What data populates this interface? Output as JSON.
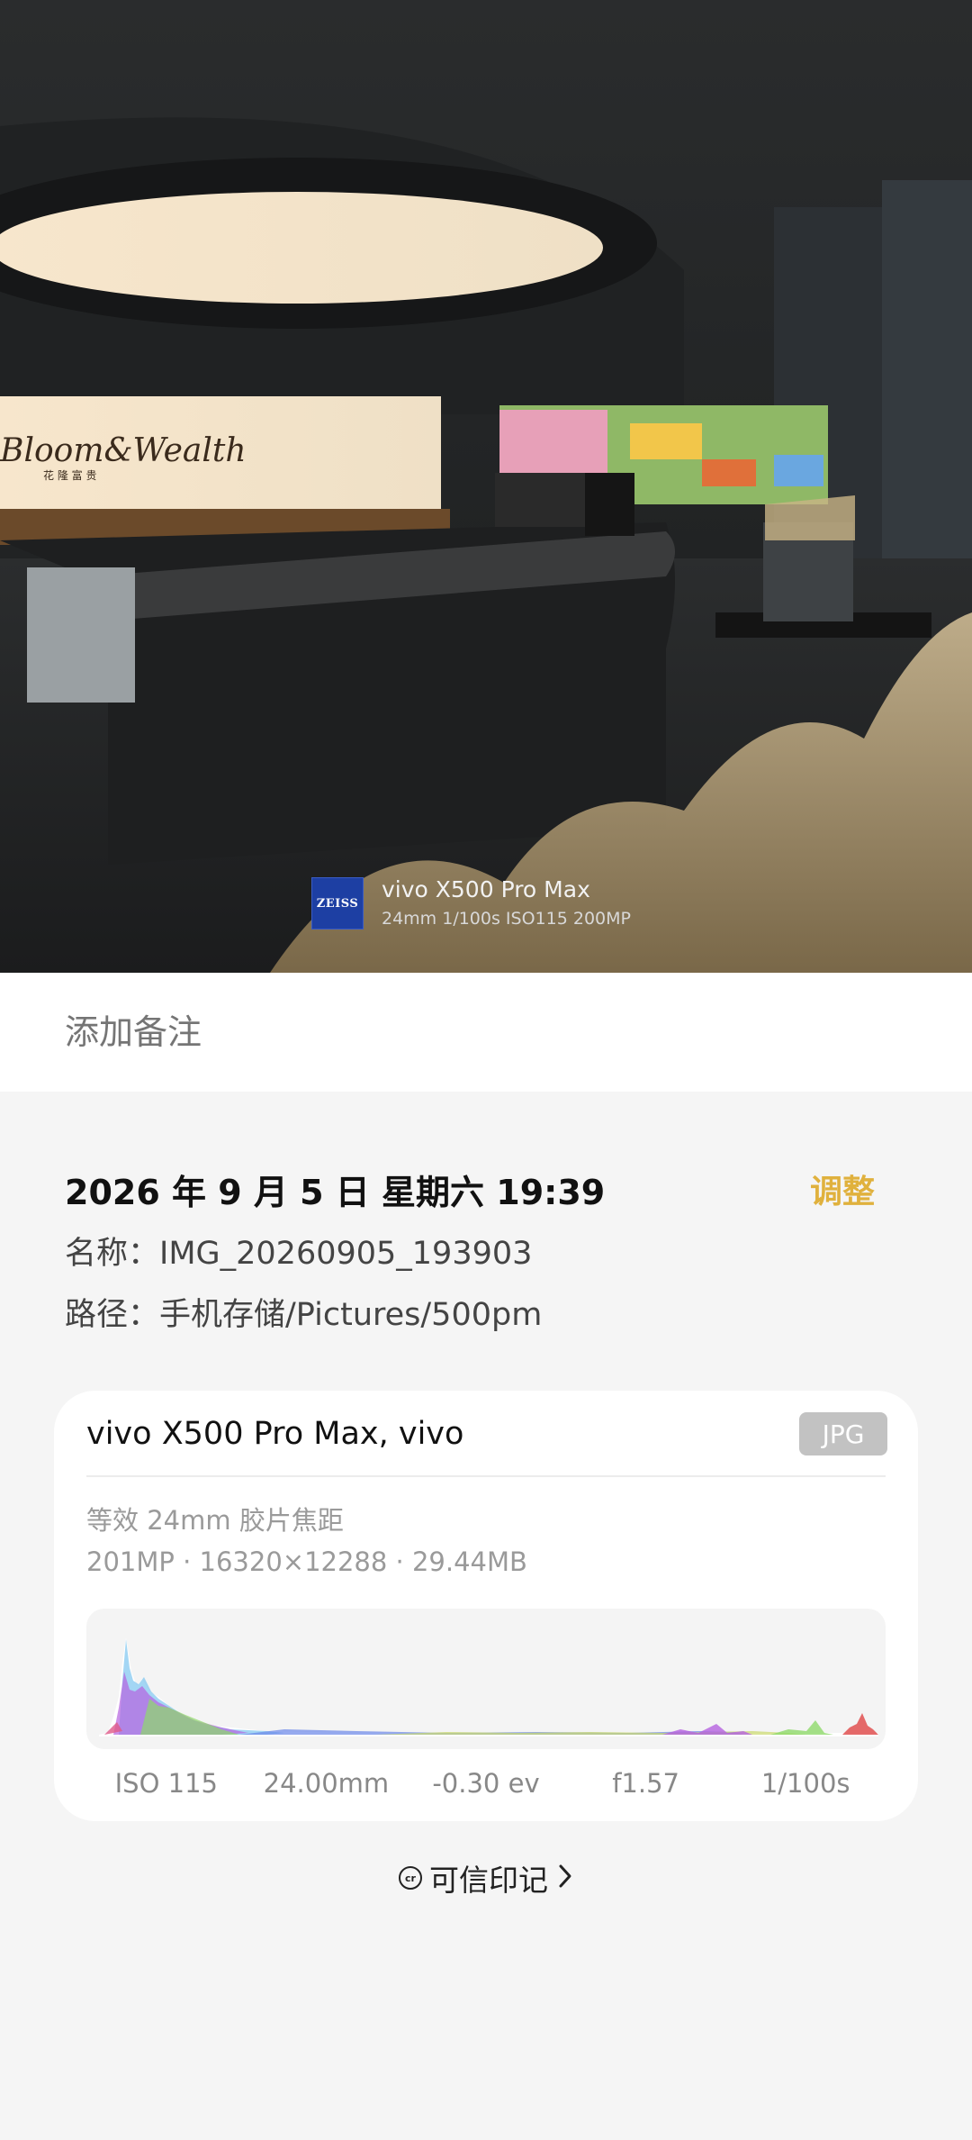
{
  "photo": {
    "watermark": {
      "logo_text": "ZEISS",
      "model": "vivo  X500 Pro Max",
      "params": "24mm   1/100s   ISO115   200MP"
    },
    "scene_text": {
      "sign": "Bloom&Wealth",
      "sign_sub": "花 隆 富 贵"
    }
  },
  "note": {
    "placeholder": "添加备注"
  },
  "details": {
    "datetime": "2026 年 9 月 5 日  星期六 19:39",
    "adjust_label": "调整",
    "name": "名称：IMG_20260905_193903",
    "path": "路径：手机存储/Pictures/500pm"
  },
  "card": {
    "title": "vivo X500 Pro Max,   vivo",
    "format_badge": "JPG",
    "focal_equiv": "等效 24mm 胶片焦距",
    "resolution": "201MP · 16320×12288 · 29.44MB",
    "exif": [
      "ISO 115",
      "24.00mm",
      "-0.30 ev",
      "f1.57",
      "1/100s"
    ]
  },
  "trust": {
    "icon_text": "cr",
    "label": "可信印记"
  },
  "colors": {
    "accent": "#e0b13d",
    "badge": "#c2c2c2",
    "zeiss_blue": "#1d3fa3"
  }
}
